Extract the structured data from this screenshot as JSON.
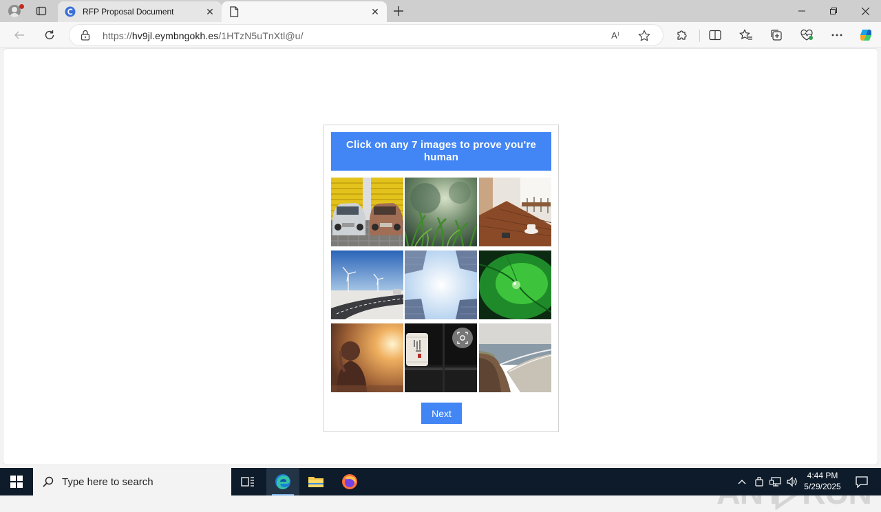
{
  "browser": {
    "tabs": [
      {
        "title": "RFP Proposal Document",
        "favicon": "c-logo-icon"
      },
      {
        "title": "",
        "favicon": "page-icon"
      }
    ],
    "url_scheme": "https://",
    "url_host": "hv9jl.eymbngokh.es",
    "url_path": "/1HTzN5uTnXtl@u/",
    "read_aloud_label": "A⁾"
  },
  "captcha": {
    "instruction": "Click on any 7 images to prove you're human",
    "tiles": [
      {
        "subject": "classic-cars-yellow-shutter"
      },
      {
        "subject": "grass-closeup"
      },
      {
        "subject": "cafe-wooden-table"
      },
      {
        "subject": "wind-turbines-road"
      },
      {
        "subject": "buildings-looking-up-sky"
      },
      {
        "subject": "green-leaf-water-drop"
      },
      {
        "subject": "woman-sunset"
      },
      {
        "subject": "paper-lantern-night"
      },
      {
        "subject": "coastal-cliff-beach"
      }
    ],
    "next_label": "Next",
    "accent_color": "#4285f4"
  },
  "watermark": {
    "text_left": "ANY",
    "text_right": "RUN"
  },
  "taskbar": {
    "search_placeholder": "Type here to search",
    "time": "4:44 PM",
    "date": "5/29/2025"
  }
}
